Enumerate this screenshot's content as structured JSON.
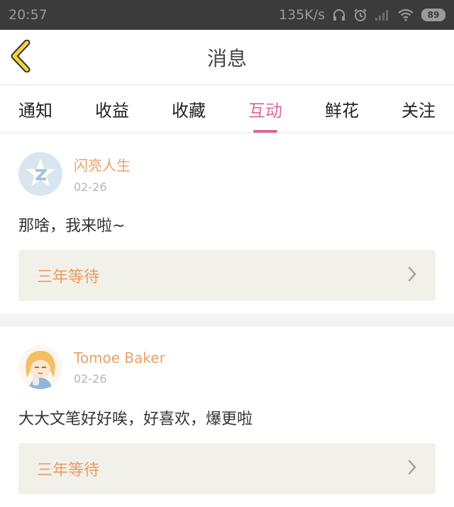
{
  "status": {
    "time": "20:57",
    "speed": "135K/s",
    "battery": "89"
  },
  "header": {
    "title": "消息"
  },
  "tabs": [
    {
      "label": "通知",
      "active": false
    },
    {
      "label": "收益",
      "active": false
    },
    {
      "label": "收藏",
      "active": false
    },
    {
      "label": "互动",
      "active": true
    },
    {
      "label": "鲜花",
      "active": false
    },
    {
      "label": "关注",
      "active": false
    }
  ],
  "messages": [
    {
      "username": "闪亮人生",
      "date": "02-26",
      "comment": "那啥，我来啦~",
      "reference": "三年等待",
      "avatar": "qq-star-avatar"
    },
    {
      "username": "Tomoe Baker",
      "date": "02-26",
      "comment": "大大文笔好好唉，好喜欢，爆更啦",
      "reference": "三年等待",
      "avatar": "anime-girl-avatar"
    }
  ],
  "colors": {
    "accent": "#d96a9b",
    "username": "#e9a06a",
    "reference": "#ec9a63",
    "back_arrow": "#f0d53a"
  }
}
